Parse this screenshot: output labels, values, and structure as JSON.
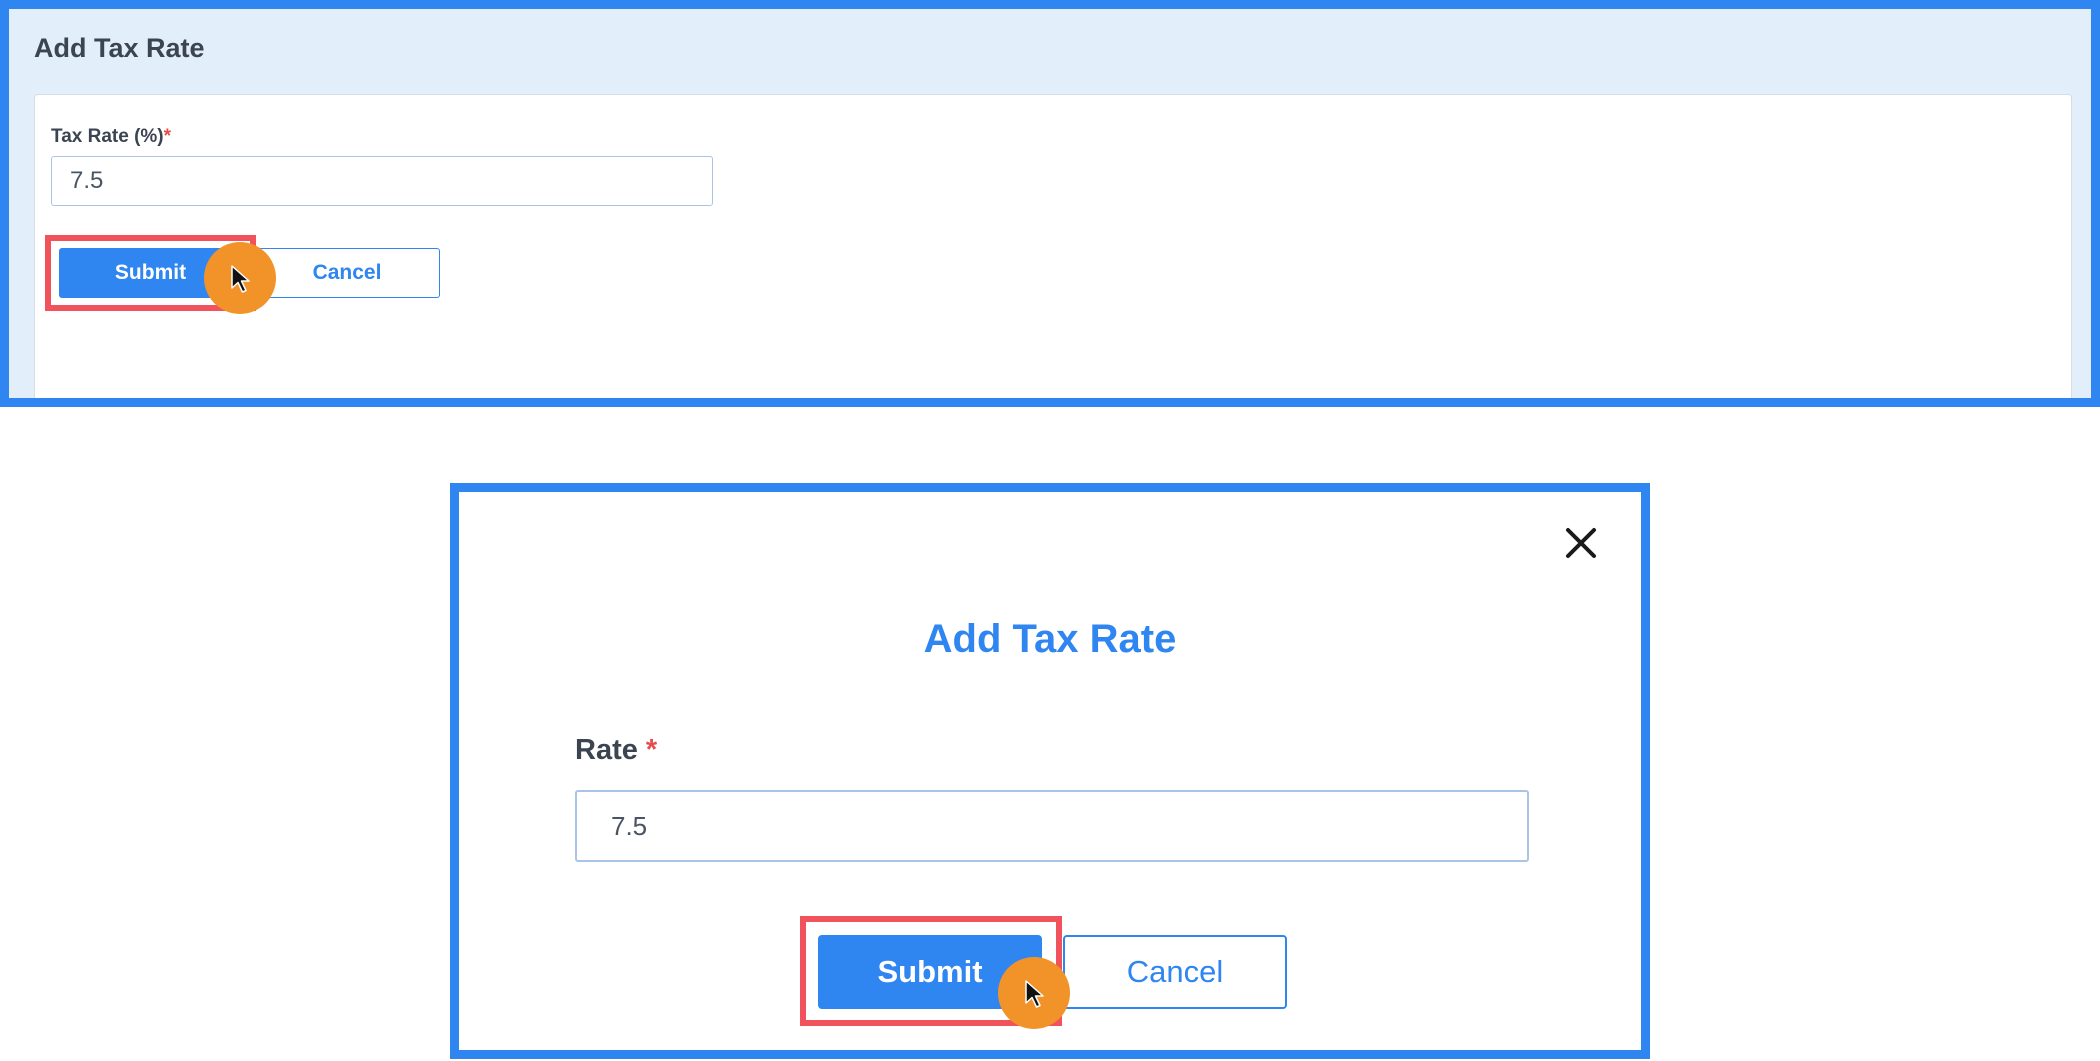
{
  "colors": {
    "accent": "#2f86f0",
    "highlight": "#f0535b",
    "cursor_marker": "#f2932a",
    "required_star": "#e84b4b",
    "top_panel_background": "#e3eefb"
  },
  "top_form": {
    "title": "Add Tax Rate",
    "field_label": "Tax Rate (%)",
    "required_mark": "*",
    "field_value": "7.5",
    "submit_label": "Submit",
    "cancel_label": "Cancel"
  },
  "modal_form": {
    "title": "Add Tax Rate",
    "field_label": "Rate",
    "required_mark": "*",
    "field_value": "7.5",
    "submit_label": "Submit",
    "cancel_label": "Cancel",
    "close_icon": "close-icon"
  },
  "cursor": {
    "icon": "mouse-pointer-icon"
  }
}
